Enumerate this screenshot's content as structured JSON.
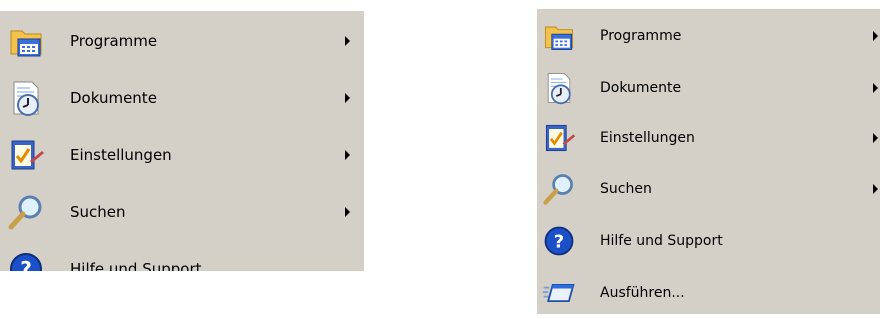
{
  "menus": [
    {
      "items": [
        {
          "label": "Programme",
          "icon": "programs-folder-icon",
          "submenu": true
        },
        {
          "label": "Dokumente",
          "icon": "documents-icon",
          "submenu": true
        },
        {
          "label": "Einstellungen",
          "icon": "settings-checklist-icon",
          "submenu": true
        },
        {
          "label": "Suchen",
          "icon": "search-magnifier-icon",
          "submenu": true
        },
        {
          "label": "Hilfe und Support",
          "icon": "help-icon",
          "submenu": false
        }
      ]
    },
    {
      "items": [
        {
          "label": "Programme",
          "icon": "programs-folder-icon",
          "submenu": true
        },
        {
          "label": "Dokumente",
          "icon": "documents-icon",
          "submenu": true
        },
        {
          "label": "Einstellungen",
          "icon": "settings-checklist-icon",
          "submenu": true
        },
        {
          "label": "Suchen",
          "icon": "search-magnifier-icon",
          "submenu": true
        },
        {
          "label": "Hilfe und Support",
          "icon": "help-icon",
          "submenu": false
        },
        {
          "label": "Ausführen...",
          "icon": "run-icon",
          "submenu": false
        }
      ]
    }
  ],
  "colors": {
    "menu_background": "#d4d0c8",
    "page_background": "#ffffff",
    "help_blue": "#1c50c8"
  }
}
